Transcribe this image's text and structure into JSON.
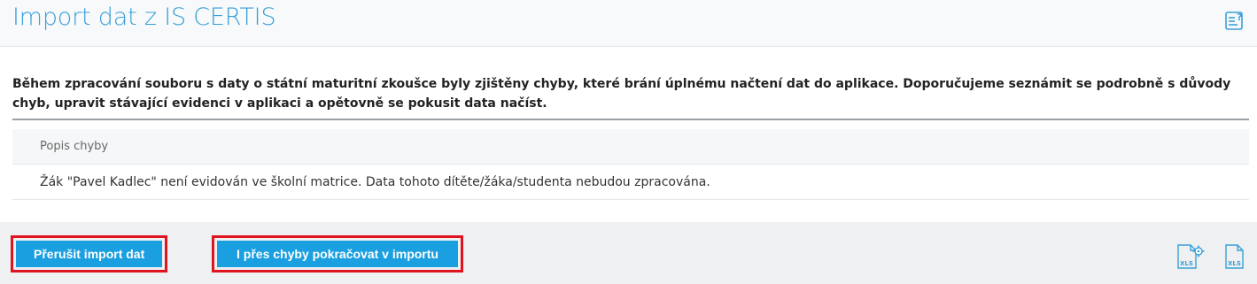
{
  "header": {
    "title": "Import dat z IS CERTIS"
  },
  "message": "Během zpracování souboru s daty o státní maturitní zkoušce byly zjištěny chyby, které brání úplnému načtení dat do aplikace. Doporučujeme seznámit se podrobně s důvody chyb, upravit stávající evidenci v aplikaci a opětovně se pokusit data načíst.",
  "errors_table": {
    "header": "Popis chyby",
    "rows": [
      "Žák \"Pavel Kadlec\" není evidován ve školní matrice. Data tohoto dítěte/žáka/studenta nebudou zpracována."
    ]
  },
  "footer": {
    "abort_label": "Přerušit import dat",
    "continue_label": "I přes chyby pokračovat v importu",
    "icons": [
      "xls-settings-icon",
      "xls-export-icon"
    ]
  },
  "colors": {
    "accent": "#3aa0d8",
    "button": "#1a9fe0",
    "highlight": "#e0141e"
  }
}
